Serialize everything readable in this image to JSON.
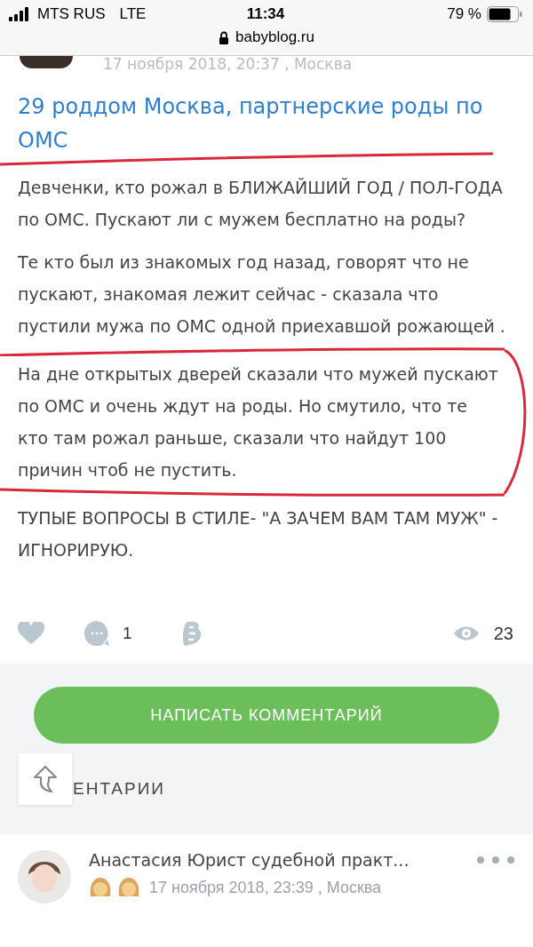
{
  "status_bar": {
    "carrier": "MTS RUS",
    "network": "LTE",
    "time": "11:34",
    "battery": "79 %"
  },
  "address_bar": {
    "url": "babyblog.ru"
  },
  "post": {
    "meta": "17 ноября 2018, 20:37 , Москва",
    "title": "29 роддом Москва, партнерские роды по ОМС",
    "paragraphs": [
      "Девченки, кто рожал в БЛИЖАЙШИЙ ГОД / ПОЛ-ГОДА по ОМС. Пускают ли с мужем бесплатно на роды?",
      "Те кто был из знакомых год назад, говорят что не пускают, знакомая лежит сейчас - сказала что пустили мужа по ОМС одной приехавшой рожающей .",
      "На дне открытых дверей сказали что мужей пускают по ОМС и очень ждут на роды. Но смутило, что те кто там рожал раньше, сказали что найдут 100 причин чтоб не пустить.",
      "ТУПЫЕ ВОПРОСЫ В СТИЛЕ- \"А ЗАЧЕМ ВАМ ТАМ МУЖ\" - ИГНОРИРУЮ."
    ],
    "liked": false,
    "comments_count": "1",
    "views": "23"
  },
  "comment_button": "НАПИСАТЬ КОММЕНТАРИЙ",
  "comments_heading": "ЕНТАРИИ",
  "comments": [
    {
      "author": "Анастасия Юрист судебной практ...",
      "date": "17 ноября 2018, 23:39 , Москва"
    }
  ]
}
